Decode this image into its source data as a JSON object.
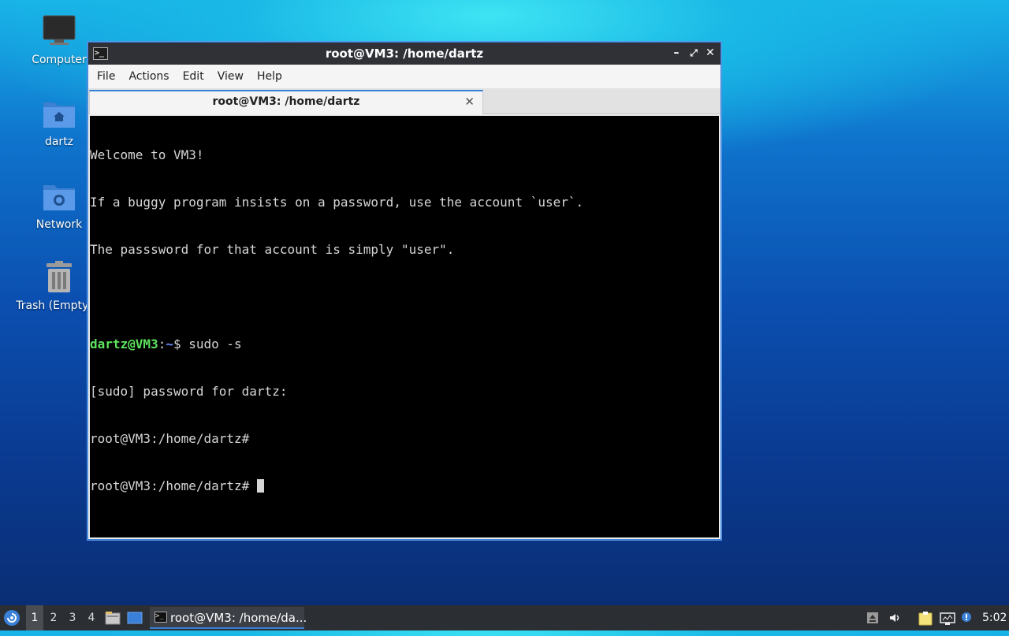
{
  "desktop": {
    "icons": [
      {
        "label": "Computer",
        "icon": "computer-icon"
      },
      {
        "label": "dartz",
        "icon": "home-folder-icon"
      },
      {
        "label": "Network",
        "icon": "network-folder-icon"
      },
      {
        "label": "Trash (Empty)",
        "icon": "trash-icon"
      }
    ]
  },
  "window": {
    "title": "root@VM3: /home/dartz",
    "controls": {
      "minimize": "–",
      "maximize": "⤢",
      "close": "✕"
    },
    "menu": [
      "File",
      "Actions",
      "Edit",
      "View",
      "Help"
    ],
    "tab": {
      "label": "root@VM3: /home/dartz",
      "close": "✕"
    }
  },
  "terminal": {
    "lines": [
      "Welcome to VM3!",
      "If a buggy program insists on a password, use the account `user`.",
      "The passsword for that account is simply \"user\".",
      ""
    ],
    "prompt": {
      "user": "dartz@VM3",
      "colon": ":",
      "path": "~",
      "symbol": "$ ",
      "command": "sudo -s"
    },
    "sudo_line": "[sudo] password for dartz:",
    "root_line_1": "root@VM3:/home/dartz#",
    "root_line_2": "root@VM3:/home/dartz# "
  },
  "taskbar": {
    "workspaces": [
      "1",
      "2",
      "3",
      "4"
    ],
    "active_workspace": "1",
    "task_label": "root@VM3: /home/da...",
    "clock": "5:02"
  },
  "colors": {
    "accent": "#3a80d9",
    "prompt_user": "#5ee35e",
    "prompt_path": "#6b8cff"
  }
}
